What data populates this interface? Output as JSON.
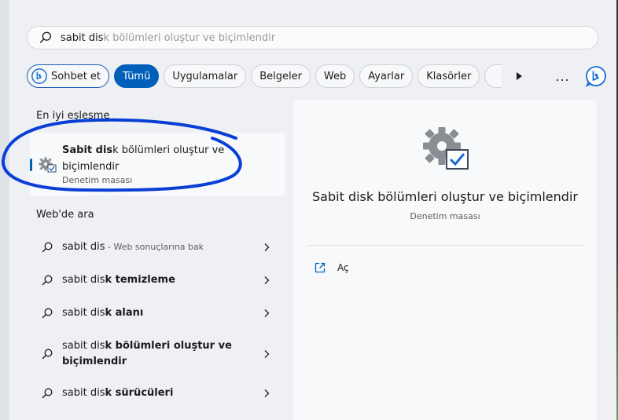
{
  "search": {
    "typed": "sabit dis",
    "suggestion_rest": "k bölümleri oluştur ve biçimlendir"
  },
  "filters": {
    "sohbet": "Sohbet et",
    "items": [
      "Tümü",
      "Uygulamalar",
      "Belgeler",
      "Web",
      "Ayarlar",
      "Klasörler"
    ],
    "active_index": 0,
    "more": "..."
  },
  "best_match": {
    "section_title": "En iyi eşleşme",
    "title_bold": "Sabit dis",
    "title_rest": "k bölümleri oluştur ve biçimlendir",
    "subtitle": "Denetim masası"
  },
  "web": {
    "section_title": "Web'de ara",
    "results": [
      {
        "prefix": "sabit dis",
        "bold": "",
        "hint": " - Web sonuçlarına bak"
      },
      {
        "prefix": "sabit dis",
        "bold": "k temizleme",
        "hint": ""
      },
      {
        "prefix": "sabit dis",
        "bold": "k alanı",
        "hint": ""
      },
      {
        "prefix": "sabit dis",
        "bold": "k bölümleri oluştur ve biçimlendir",
        "hint": ""
      },
      {
        "prefix": "sabit dis",
        "bold": "k sürücüleri",
        "hint": ""
      }
    ]
  },
  "detail": {
    "title": "Sabit disk bölümleri oluştur ve biçimlendir",
    "subtitle": "Denetim masası",
    "open_label": "Aç"
  },
  "colors": {
    "accent": "#005fb8",
    "annotation": "#0a3fd6"
  },
  "icons": {
    "search": "search-icon",
    "bing": "bing-icon",
    "gear": "gear-checkbox-icon",
    "open": "open-external-icon",
    "chevron": "chevron-right-icon"
  }
}
